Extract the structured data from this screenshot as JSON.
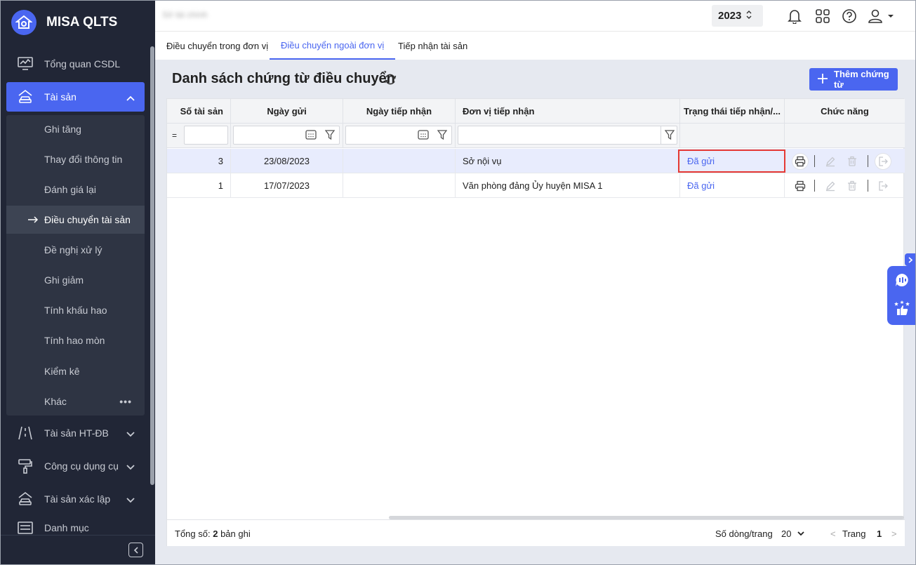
{
  "app": {
    "name": "MISA QLTS",
    "unit_name": "Sở tài chính"
  },
  "header": {
    "year": "2023"
  },
  "sidebar": {
    "items": [
      {
        "label": "Tổng quan CSDL",
        "icon": "monitor-chart-icon"
      },
      {
        "label": "Tài sản",
        "icon": "house-car-icon",
        "active": true
      },
      {
        "label": "Tài sản HT-ĐB",
        "icon": "road-icon"
      },
      {
        "label": "Công cụ dụng cụ",
        "icon": "paint-roller-icon"
      },
      {
        "label": "Tài sản xác lập",
        "icon": "car-icon"
      },
      {
        "label": "Danh mục",
        "icon": "list-icon"
      }
    ],
    "subitems": [
      {
        "label": "Ghi tăng"
      },
      {
        "label": "Thay đổi thông tin"
      },
      {
        "label": "Đánh giá lại"
      },
      {
        "label": "Điều chuyển tài sản",
        "active": true
      },
      {
        "label": "Đề nghị xử lý"
      },
      {
        "label": "Ghi giảm"
      },
      {
        "label": "Tính khấu hao"
      },
      {
        "label": "Tính hao mòn"
      },
      {
        "label": "Kiểm kê"
      },
      {
        "label": "Khác"
      }
    ]
  },
  "tabs": [
    {
      "label": "Điều chuyển trong đơn vị"
    },
    {
      "label": "Điều chuyển ngoài đơn vị",
      "active": true
    },
    {
      "label": "Tiếp nhận tài sản"
    }
  ],
  "page": {
    "title": "Danh sách chứng từ điều chuyển",
    "add_button": "Thêm chứng từ"
  },
  "table": {
    "columns": [
      "Số tài sản",
      "Ngày gửi",
      "Ngày tiếp nhận",
      "Đơn vị tiếp nhận",
      "Trạng thái tiếp nhận/...",
      "Chức năng"
    ],
    "filter_operator": "=",
    "rows": [
      {
        "count": "3",
        "sent_date": "23/08/2023",
        "received_date": "",
        "receiver": "Sở nội vụ",
        "status": "Đã gửi"
      },
      {
        "count": "1",
        "sent_date": "17/07/2023",
        "received_date": "",
        "receiver": "Văn phòng đảng Ủy huyện MISA 1",
        "status": "Đã gửi"
      }
    ]
  },
  "footer": {
    "total_label": "Tổng số:",
    "total_count": "2",
    "total_suffix": "bản ghi",
    "page_size_label": "Số dòng/trang",
    "page_size": "20",
    "page_label": "Trang",
    "page_number": "1"
  },
  "colors": {
    "accent": "#4a66f0",
    "sidebar_bg": "#212636",
    "highlight_border": "#e53935"
  }
}
